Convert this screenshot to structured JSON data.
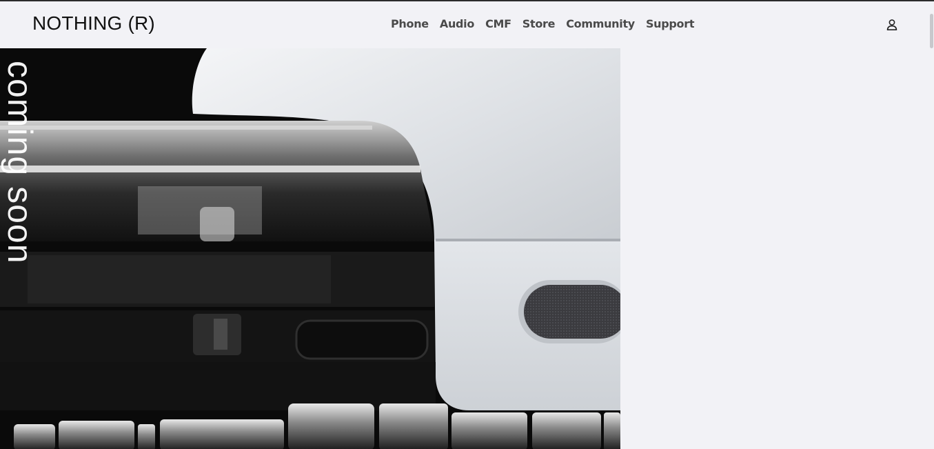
{
  "brand": {
    "logo_text": "NOTHING (R)"
  },
  "nav": {
    "items": [
      {
        "label": "Phone"
      },
      {
        "label": "Audio"
      },
      {
        "label": "CMF"
      },
      {
        "label": "Store"
      },
      {
        "label": "Community"
      },
      {
        "label": "Support"
      }
    ]
  },
  "account": {
    "icon": "user-icon"
  },
  "hero": {
    "overlay_text": "coming soon"
  },
  "colors": {
    "background": "#f2f2f6",
    "nav_text": "#4a4a4a",
    "logo_text": "#111111",
    "overlay_text": "#ffffff"
  }
}
